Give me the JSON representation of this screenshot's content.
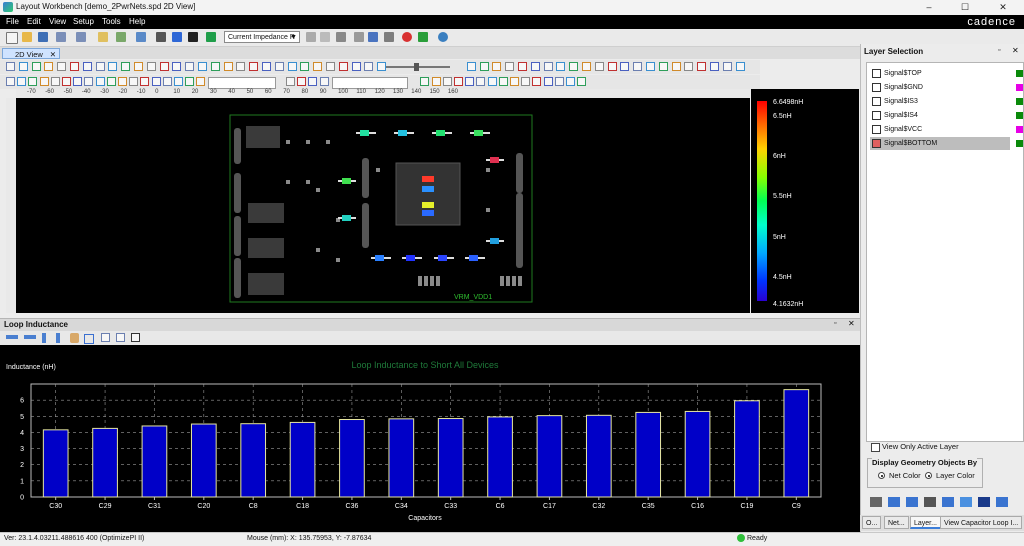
{
  "window": {
    "title": "Layout Workbench [demo_2PwrNets.spd 2D View]",
    "minimize": "–",
    "maximize": "☐",
    "close": "✕"
  },
  "menu": {
    "items": [
      "File",
      "Edit",
      "View",
      "Setup",
      "Tools",
      "Help"
    ],
    "brand": "cadence"
  },
  "toolbar": {
    "mode_combo": "Current Impedance R"
  },
  "view_tab": {
    "label": "2D View"
  },
  "ruler": {
    "ticks": [
      "-70",
      "-60",
      "-50",
      "-40",
      "-30",
      "-20",
      "-10",
      "0",
      "10",
      "20",
      "30",
      "40",
      "50",
      "60",
      "70",
      "80",
      "90",
      "100",
      "110",
      "120",
      "130",
      "140",
      "150",
      "160"
    ]
  },
  "board": {
    "label": "VRM_VDD1"
  },
  "colorbar": {
    "labels": [
      "6.6498nH",
      "6.5nH",
      "6nH",
      "5.5nH",
      "5nH",
      "4.5nH",
      "4.1632nH"
    ]
  },
  "loop_panel": {
    "title": "Loop Inductance"
  },
  "chart_data": {
    "type": "bar",
    "title": "Loop Inductance to Short All Devices",
    "ylabel": "Inductance (nH)",
    "xlabel": "Capacitors",
    "ylim": [
      0,
      7
    ],
    "yticks": [
      "0",
      "1",
      "2",
      "3",
      "4",
      "5",
      "6"
    ],
    "categories": [
      "C30",
      "C29",
      "C31",
      "C20",
      "C8",
      "C18",
      "C36",
      "C34",
      "C33",
      "C6",
      "C17",
      "C32",
      "C35",
      "C16",
      "C19",
      "C9"
    ],
    "values": [
      4.16,
      4.25,
      4.4,
      4.52,
      4.54,
      4.62,
      4.8,
      4.84,
      4.86,
      4.96,
      5.04,
      5.06,
      5.24,
      5.3,
      5.96,
      6.65
    ],
    "bar_color": "#0000c8",
    "bar_edge": "#e8e8a0",
    "title_color": "#1f7a3a",
    "grid": true
  },
  "layer_panel": {
    "title": "Layer Selection",
    "layers": [
      {
        "name": "Signal$TOP",
        "color": "#0a8a0a",
        "selected": false
      },
      {
        "name": "Signal$GND",
        "color": "#e600e6",
        "selected": false
      },
      {
        "name": "Signal$IS3",
        "color": "#0a8a0a",
        "selected": false
      },
      {
        "name": "Signal$IS4",
        "color": "#0a8a0a",
        "selected": false
      },
      {
        "name": "Signal$VCC",
        "color": "#e600e6",
        "selected": false
      },
      {
        "name": "Signal$BOTTOM",
        "color": "#0a8a0a",
        "selected": true
      }
    ],
    "view_only_active": "View Only Active Layer",
    "display_group_title": "Display Geometry Objects By",
    "net_color": "Net Color",
    "layer_color": "Layer Color"
  },
  "bottom_tabs": [
    "O...",
    "Net...",
    "Layer...",
    "View Capacitor Loop I..."
  ],
  "status": {
    "version": "Ver: 23.1.4.03211.488616 400 (OptimizePI II)",
    "mouse": "Mouse (mm): X: 135.75953, Y: -7.87634",
    "ready": "Ready"
  }
}
